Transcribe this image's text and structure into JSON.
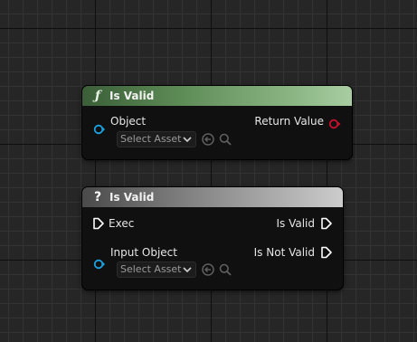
{
  "node_is_valid_function": {
    "title": "Is Valid",
    "header_icon": "function-f-icon",
    "header_glyph": "ƒ",
    "header_color": "#5c8a55",
    "input_pin_label": "Object",
    "asset_picker_value": "Select Asset",
    "output_pin_label": "Return Value",
    "object_pin_color": "#1ba3e0",
    "bool_pin_color": "#c8102e"
  },
  "node_is_valid_macro": {
    "title": "Is Valid",
    "header_icon": "question-mark-icon",
    "header_glyph": "?",
    "header_color": "#7a7a7a",
    "exec_in_label": "Exec",
    "input_pin_label": "Input Object",
    "asset_picker_value": "Select Asset",
    "output_valid_label": "Is Valid",
    "output_not_valid_label": "Is Not Valid",
    "exec_pin_color": "#ffffff",
    "object_pin_color": "#1ba3e0"
  }
}
